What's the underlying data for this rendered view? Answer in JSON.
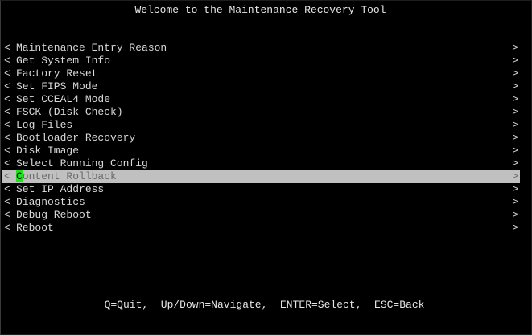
{
  "window": {
    "title": "Welcome to the Maintenance Recovery Tool"
  },
  "menu": {
    "left_marker": "<",
    "right_marker": ">",
    "selected_index": 10,
    "items": [
      {
        "label": "Maintenance Entry Reason"
      },
      {
        "label": "Get System Info"
      },
      {
        "label": "Factory Reset"
      },
      {
        "label": "Set FIPS Mode"
      },
      {
        "label": "Set CCEAL4 Mode"
      },
      {
        "label": "FSCK (Disk Check)"
      },
      {
        "label": "Log Files"
      },
      {
        "label": "Bootloader Recovery"
      },
      {
        "label": "Disk Image"
      },
      {
        "label": "Select Running Config"
      },
      {
        "label": "Content Rollback",
        "cursor_char": "C",
        "rest": "ontent Rollback"
      },
      {
        "label": "Set IP Address"
      },
      {
        "label": "Diagnostics"
      },
      {
        "label": "Debug Reboot"
      },
      {
        "label": "Reboot"
      }
    ]
  },
  "footer": {
    "help_text": "Q=Quit,  Up/Down=Navigate,  ENTER=Select,  ESC=Back"
  },
  "colors": {
    "background": "#000000",
    "text": "#d8d8d8",
    "selection_bar": "#c0c0c0",
    "selection_text": "#6a6a6a",
    "cursor": "#22e022"
  }
}
